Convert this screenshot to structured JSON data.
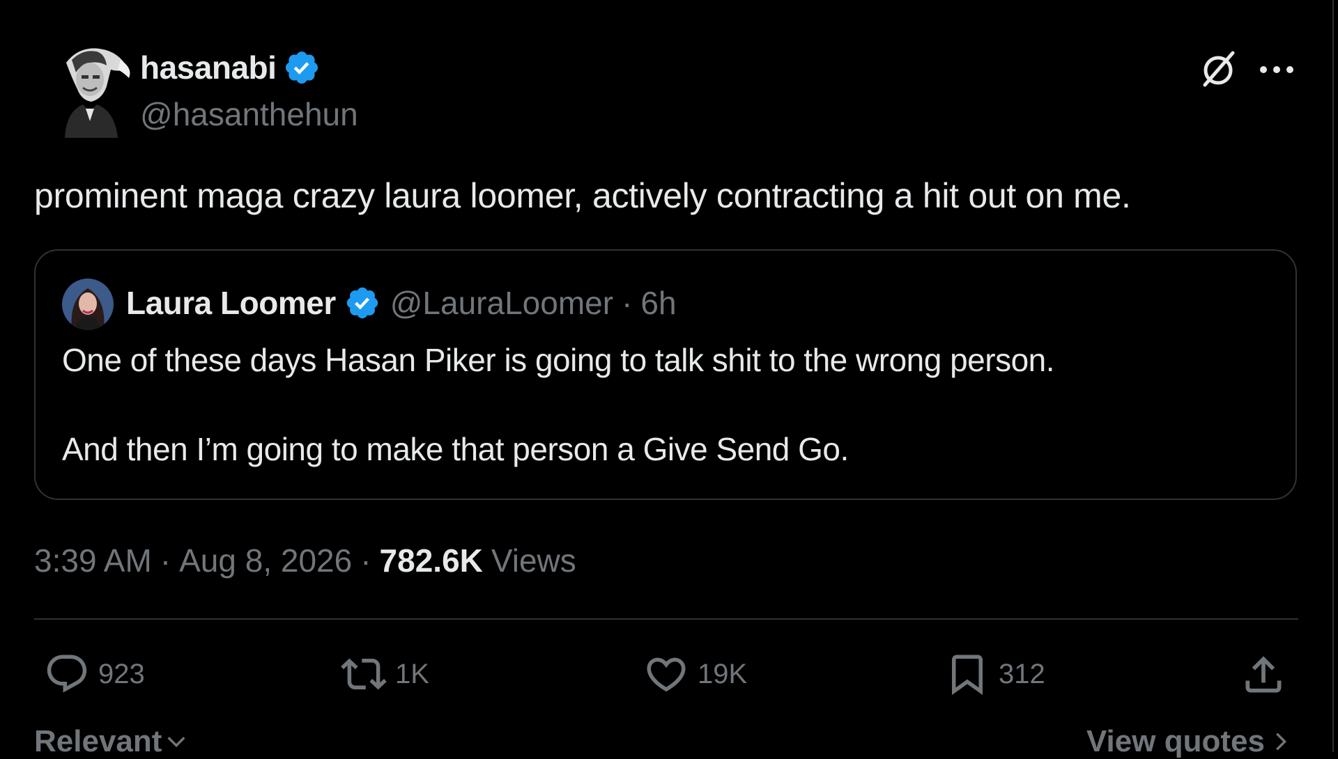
{
  "tweet": {
    "author": {
      "name": "hasanabi",
      "handle": "@hasanthehun",
      "verified": true,
      "avatar": "portrait-avatar"
    },
    "header_icons": {
      "grok": "grok-icon",
      "more": "more-icon"
    },
    "text": "prominent maga crazy laura loomer, actively contracting a hit out on me.",
    "quote": {
      "name": "Laura Loomer",
      "handle": "@LauraLoomer",
      "separator": "·",
      "time": "6h",
      "line1": "One of these days Hasan Piker is going to talk shit to the wrong person.",
      "line2": "And then I’m going to make that person a Give Send Go."
    },
    "meta": {
      "time": "3:39 AM",
      "date": "Aug 8, 2026",
      "views_count": "782.6K",
      "views_label": "Views"
    },
    "actions": {
      "replies": "923",
      "reposts": "1K",
      "likes": "19K",
      "bookmarks": "312"
    },
    "footer": {
      "sort_label": "Relevant",
      "view_quotes_label": "View quotes"
    }
  },
  "colors": {
    "background": "#000000",
    "text_primary": "#e7e9ea",
    "text_secondary": "#71767b",
    "verified_blue": "#1d9bf0",
    "border": "#2f3336"
  }
}
